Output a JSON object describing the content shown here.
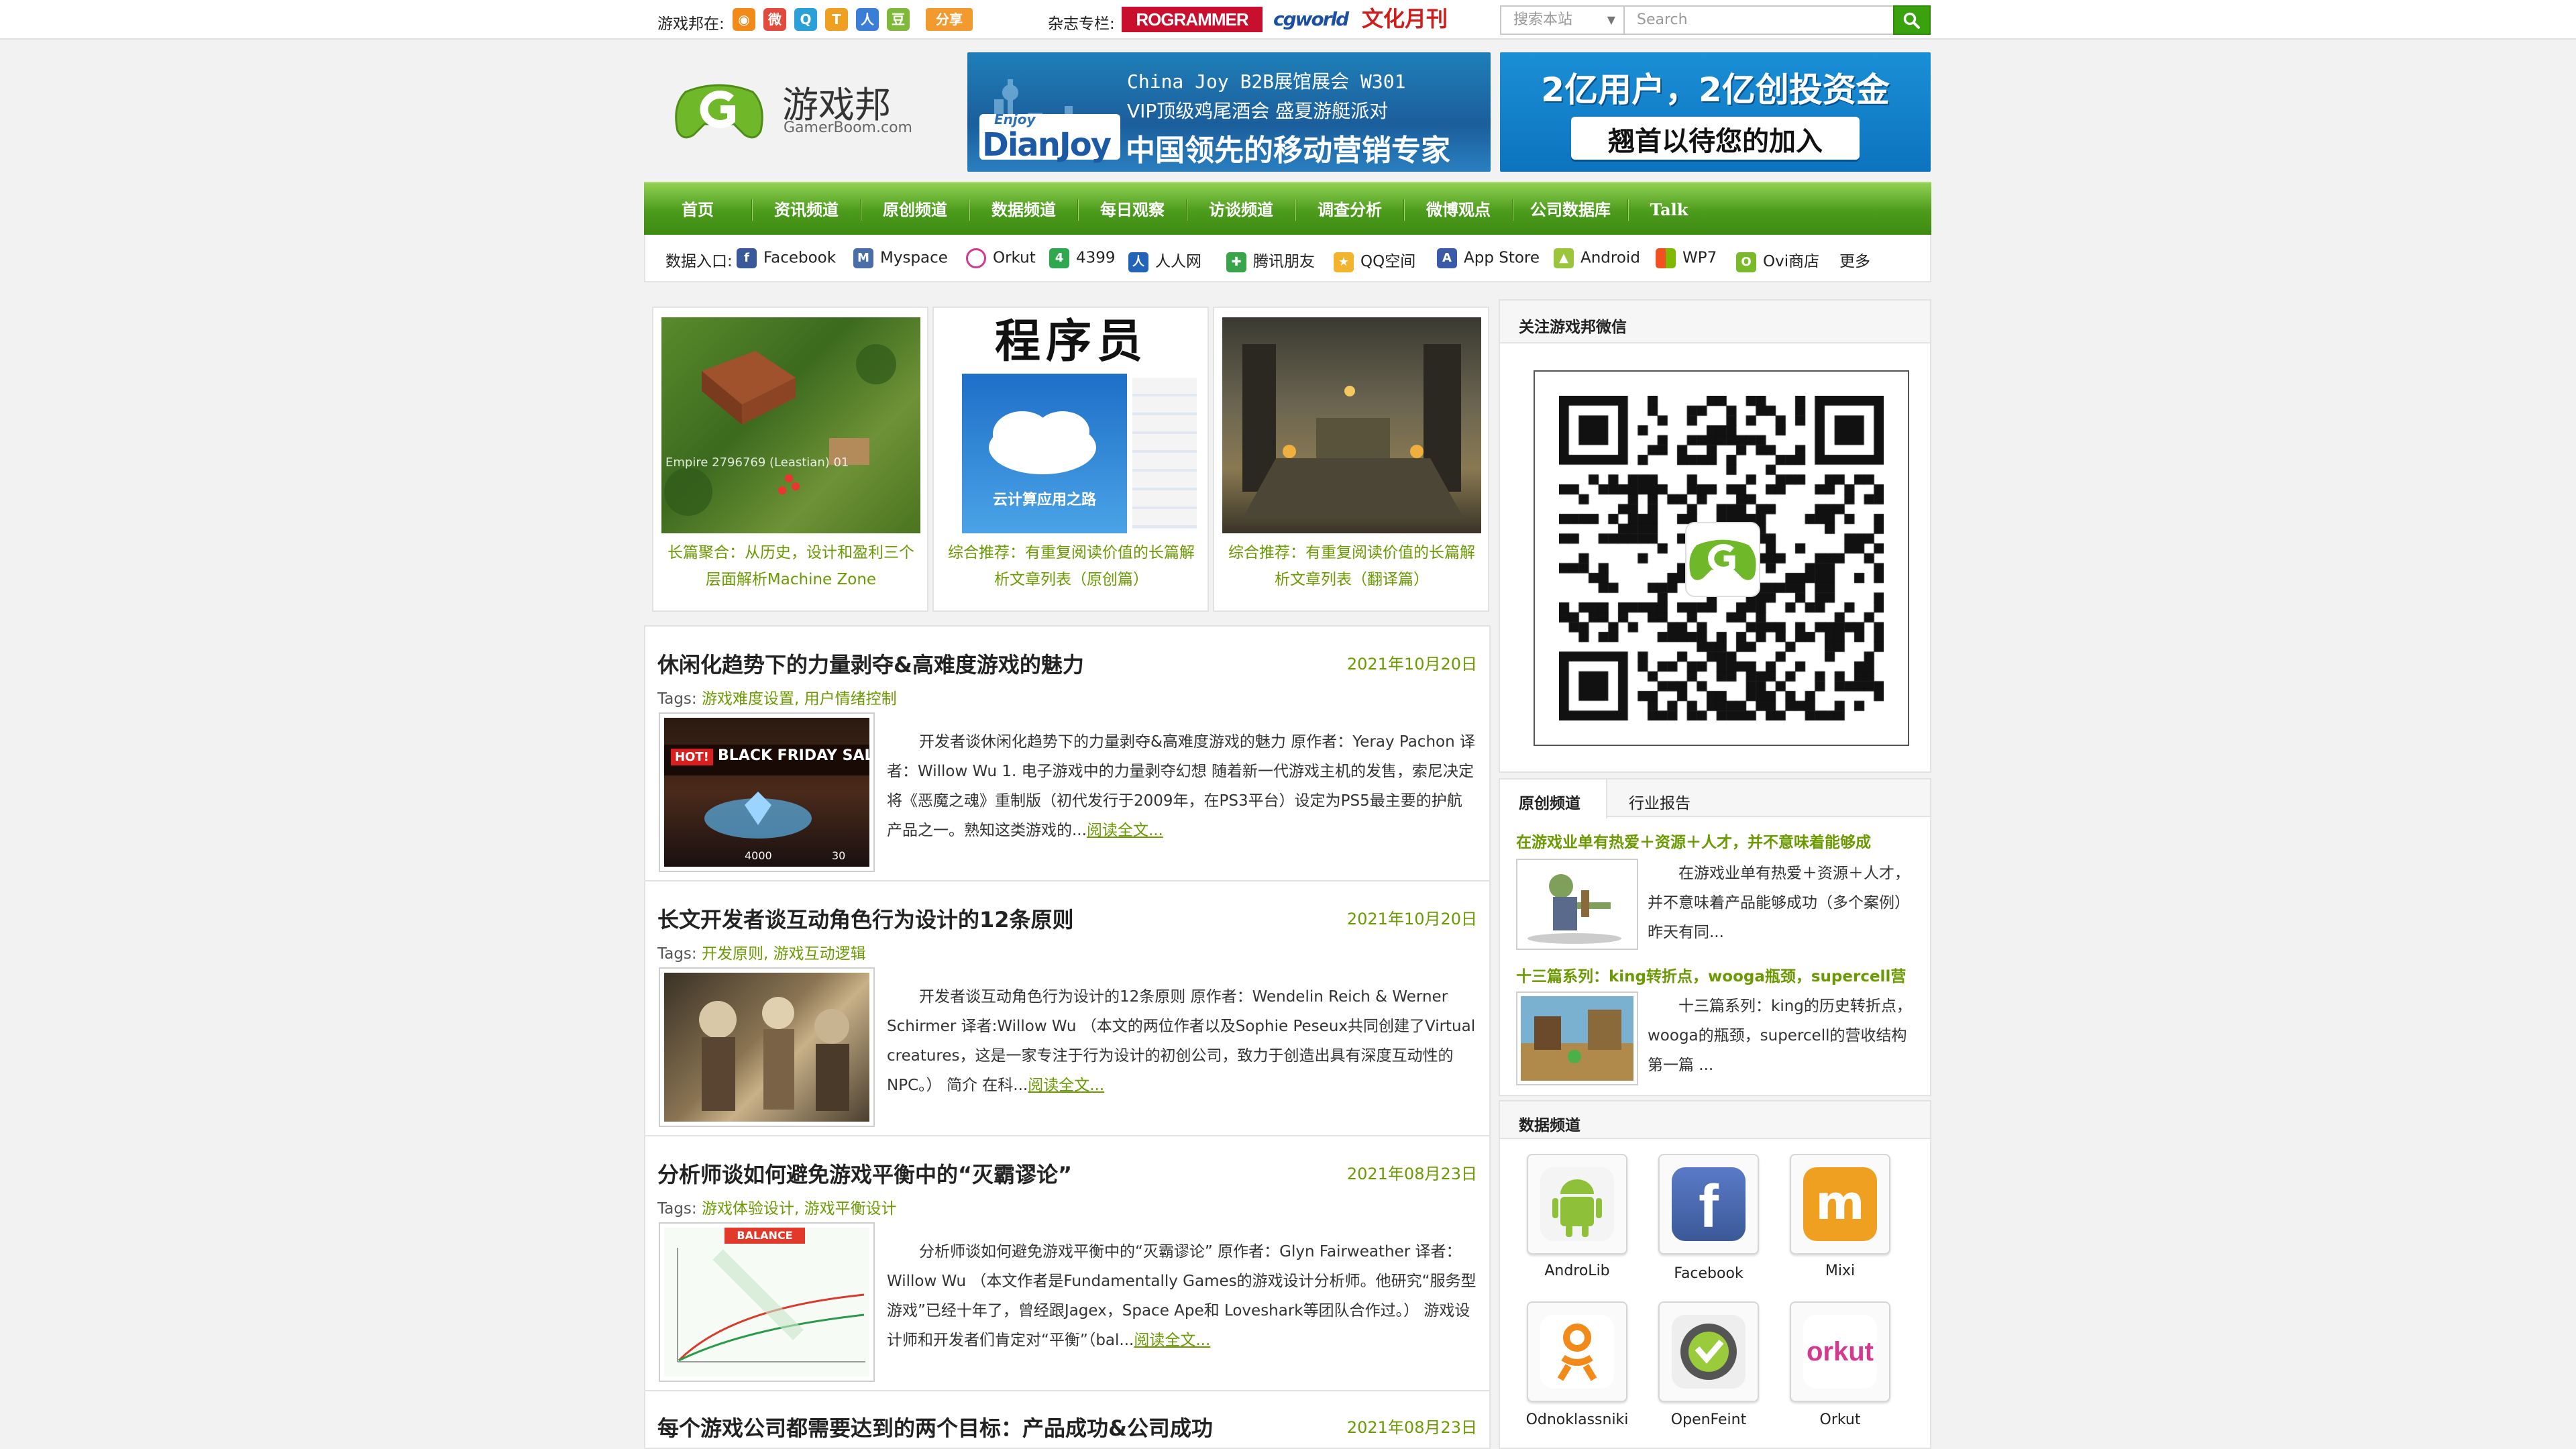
{
  "topbar": {
    "site_on_label": "游戏邦在:",
    "share_label": "分享",
    "magazine_label": "杂志专栏:",
    "magazines": [
      "ROGRAMMER",
      "cgworld",
      "文化月刊"
    ],
    "search_scope": "搜索本站",
    "search_placeholder": "Search"
  },
  "logo": {
    "name": "游戏邦",
    "domain": "GamerBoom.com"
  },
  "banner1": {
    "line1": "China Joy B2B展馆展会 W301",
    "line2": "VIP顶级鸡尾酒会  盛夏游艇派对",
    "brand_top": "Enjoy",
    "brand": "DianJoy",
    "line3": "中国领先的移动营销专家"
  },
  "banner2": {
    "line1": "2亿用户，2亿创投资金",
    "line2": "翘首以待您的加入"
  },
  "nav": [
    "首页",
    "资讯频道",
    "原创频道",
    "数据频道",
    "每日观察",
    "访谈频道",
    "调查分析",
    "微博观点",
    "公司数据库",
    "Talk Time"
  ],
  "data_entry": {
    "label": "数据入口:",
    "items": [
      "Facebook",
      "Myspace",
      "Orkut",
      "4399",
      "人人网",
      "腾讯朋友",
      "QQ空间",
      "App Store",
      "Android",
      "WP7",
      "Ovi商店"
    ],
    "more": "更多"
  },
  "featured": [
    {
      "caption": "长篇聚合：从历史，设计和盈利三个层面解析Machine Zone",
      "overlay": "Empire 2796769 (Leastian) 01"
    },
    {
      "caption": "综合推荐：有重复阅读价值的长篇解析文章列表（原创篇）",
      "mag_title": "程序员",
      "mag_sub": "云计算应用之路"
    },
    {
      "caption": "综合推荐：有重复阅读价值的长篇解析文章列表（翻译篇）"
    }
  ],
  "articles": [
    {
      "title": "休闲化趋势下的力量剥夺&高难度游戏的魅力",
      "date": "2021年10月20日",
      "tags_label": "Tags:",
      "tags": "游戏难度设置, 用户情绪控制",
      "text": "开发者谈休闲化趋势下的力量剥夺&高难度游戏的魅力 原作者：Yeray Pachon 译者：Willow Wu 1. 电子游戏中的力量剥夺幻想 随着新一代游戏主机的发售，索尼决定将《恶魔之魂》重制版（初代发行于2009年，在PS3平台）设定为PS5最主要的护航产品之一。熟知这类游戏的...",
      "more": "阅读全文...",
      "thumb_text": "BLACK FRIDAY SALE!",
      "thumb_hot": "HOT!",
      "thumb_num1": "4000",
      "thumb_num2": "30"
    },
    {
      "title": "长文开发者谈互动角色行为设计的12条原则",
      "date": "2021年10月20日",
      "tags_label": "Tags:",
      "tags": "开发原则, 游戏互动逻辑",
      "text": "开发者谈互动角色行为设计的12条原则 原作者：Wendelin Reich & Werner Schirmer 译者:Willow Wu （本文的两位作者以及Sophie Peseux共同创建了Virtual creatures，这是一家专注于行为设计的初创公司，致力于创造出具有深度互动性的NPC。） 简介 在科...",
      "more": "阅读全文..."
    },
    {
      "title": "分析师谈如何避免游戏平衡中的“灭霸谬论”",
      "date": "2021年08月23日",
      "tags_label": "Tags:",
      "tags": "游戏体验设计, 游戏平衡设计",
      "text": "分析师谈如何避免游戏平衡中的“灭霸谬论” 原作者：Glyn Fairweather 译者：Willow Wu （本文作者是Fundamentally Games的游戏设计分析师。他研究“服务型游戏”已经十年了，曾经跟Jagex，Space Ape和 Loveshark等团队合作过。） 游戏设计师和开发者们肯定对“平衡”（bal...",
      "more": "阅读全文...",
      "thumb_text": "BALANCE"
    },
    {
      "title": "每个游戏公司都需要达到的两个目标：产品成功&公司成功",
      "date": "2021年08月23日"
    }
  ],
  "sidebar": {
    "wechat_title": "关注游戏邦微信",
    "tabs": [
      "原创频道",
      "行业报告"
    ],
    "posts": [
      {
        "title": "在游戏业单有热爱＋资源＋人才，并不意味着能够成",
        "text": "在游戏业单有热爱＋资源＋人才，并不意味着产品能够成功（多个案例） 昨天有同..."
      },
      {
        "title": "十三篇系列：king转折点，wooga瓶颈，supercell营",
        "text": "十三篇系列：king的历史转折点，wooga的瓶颈，supercell的营收结构 第一篇 ..."
      }
    ],
    "data_title": "数据频道",
    "apps": [
      "AndroLib",
      "Facebook",
      "Mixi",
      "Odnoklassniki",
      "OpenFeint",
      "Orkut"
    ]
  }
}
